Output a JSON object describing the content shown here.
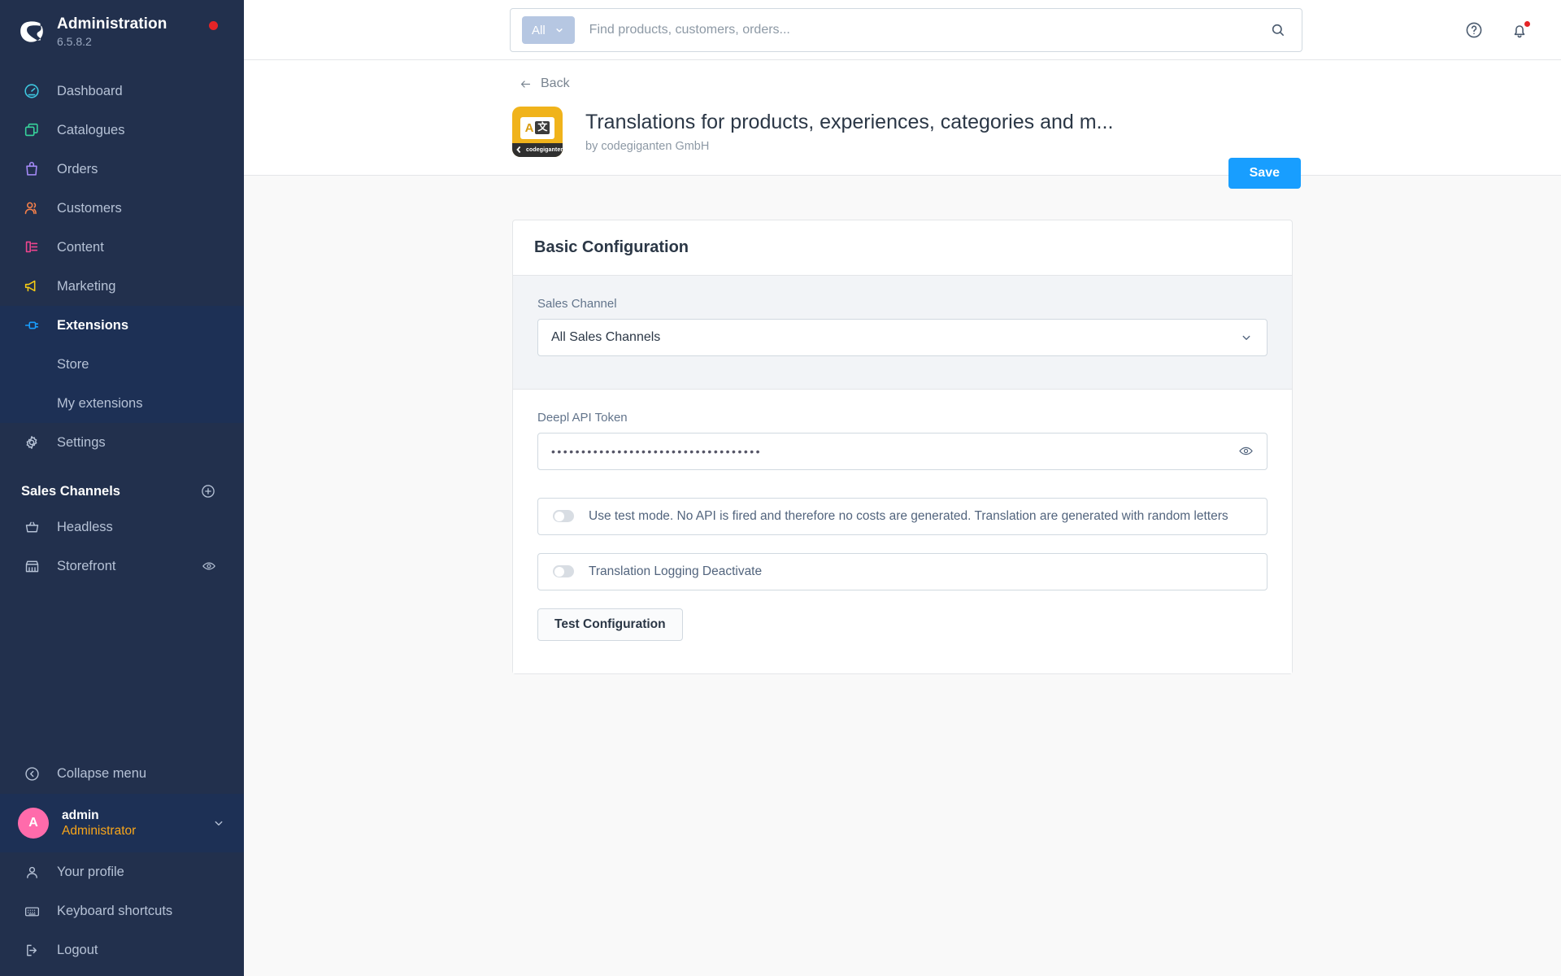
{
  "sidebar": {
    "brand": {
      "title": "Administration",
      "version": "6.5.8.2"
    },
    "nav": [
      {
        "label": "Dashboard",
        "icon": "dashboard-icon"
      },
      {
        "label": "Catalogues",
        "icon": "catalogues-icon"
      },
      {
        "label": "Orders",
        "icon": "orders-icon"
      },
      {
        "label": "Customers",
        "icon": "customers-icon"
      },
      {
        "label": "Content",
        "icon": "content-icon"
      },
      {
        "label": "Marketing",
        "icon": "marketing-icon"
      },
      {
        "label": "Extensions",
        "icon": "extensions-icon"
      }
    ],
    "sub_items": [
      {
        "label": "Store"
      },
      {
        "label": "My extensions"
      }
    ],
    "settings": {
      "label": "Settings",
      "icon": "gear-icon"
    },
    "sales_channels": {
      "title": "Sales Channels",
      "add_icon": "plus-circle-icon",
      "items": [
        {
          "label": "Headless",
          "icon": "basket-icon"
        },
        {
          "label": "Storefront",
          "icon": "storefront-icon",
          "trailing_icon": "eye-icon"
        }
      ]
    },
    "collapse": {
      "label": "Collapse menu",
      "icon": "collapse-icon"
    },
    "user": {
      "initial": "A",
      "name": "admin",
      "role": "Administrator",
      "chevron": "chevron-down-icon"
    },
    "bottom_links": [
      {
        "label": "Your profile",
        "icon": "user-icon"
      },
      {
        "label": "Keyboard shortcuts",
        "icon": "keyboard-icon"
      },
      {
        "label": "Logout",
        "icon": "logout-icon"
      }
    ]
  },
  "topbar": {
    "search": {
      "scope_label": "All",
      "scope_chevron": "chevron-down-icon",
      "placeholder": "Find products, customers, orders...",
      "value": "",
      "search_icon": "search-icon"
    },
    "help_icon": "help-circle-icon",
    "notification_icon": "bell-icon",
    "has_notification": true
  },
  "ext_header": {
    "back_label": "Back",
    "back_icon": "arrow-left-icon",
    "title": "Translations for products, experiences, categories and m...",
    "author": "by codegiganten GmbH",
    "icon": {
      "name": "translate-app-icon",
      "glyph_latin": "A",
      "glyph_cjk": "文",
      "brand_band": "codegiganten",
      "bg_color": "#f0b31b"
    },
    "save_label": "Save",
    "save_color": "#189eff"
  },
  "config": {
    "card_title": "Basic Configuration",
    "sales_channel": {
      "label": "Sales Channel",
      "value": "All Sales Channels",
      "chevron": "chevron-down-icon"
    },
    "api_token": {
      "label": "Deepl API Token",
      "masked_value": "•••••••••••••••••••••••••••••••••••",
      "reveal_icon": "eye-icon"
    },
    "toggles": [
      {
        "label": "Use test mode. No API is fired and therefore no costs are generated. Translation are generated with random letters",
        "checked": false
      },
      {
        "label": "Translation Logging Deactivate",
        "checked": false
      }
    ],
    "test_button": "Test Configuration"
  }
}
